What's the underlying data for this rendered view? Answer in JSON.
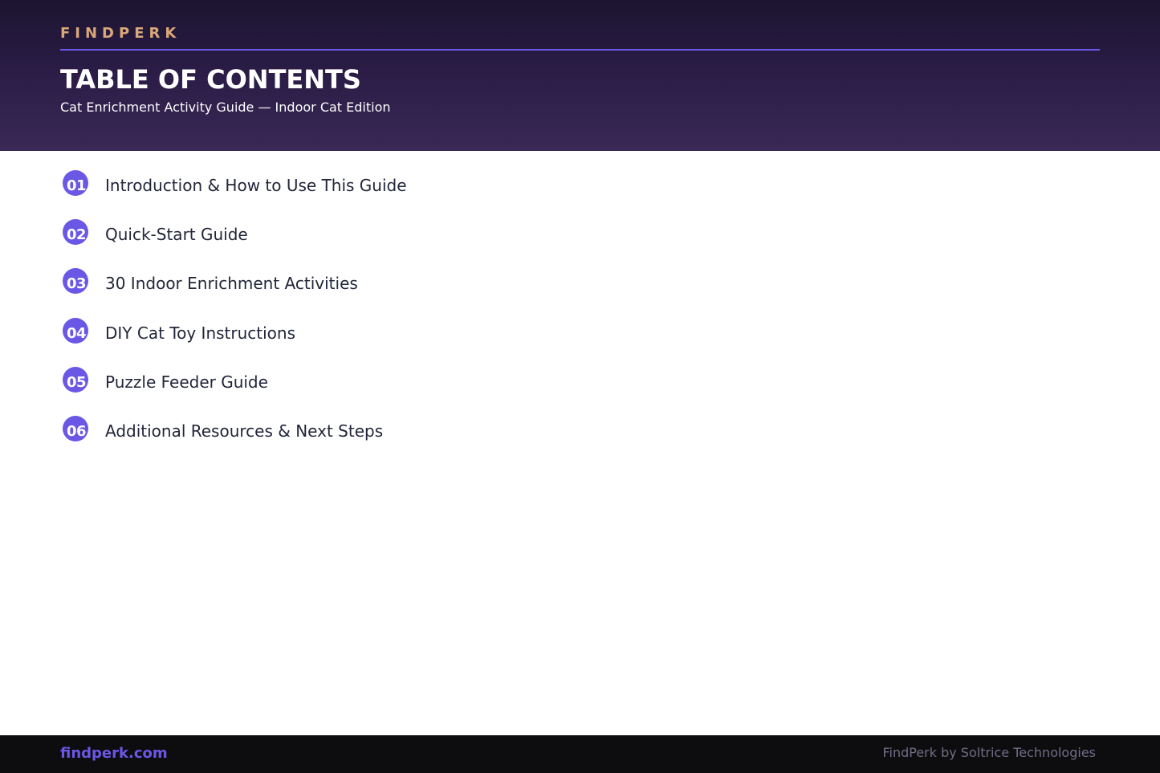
{
  "header": {
    "brand": "FINDPERK",
    "title": "TABLE OF CONTENTS",
    "subtitle": "Cat Enrichment Activity Guide — Indoor Cat Edition"
  },
  "toc": {
    "items": [
      {
        "number": "01",
        "label": "Introduction & How to Use This Guide"
      },
      {
        "number": "02",
        "label": "Quick-Start Guide"
      },
      {
        "number": "03",
        "label": "30 Indoor Enrichment Activities"
      },
      {
        "number": "04",
        "label": "DIY Cat Toy Instructions"
      },
      {
        "number": "05",
        "label": "Puzzle Feeder Guide"
      },
      {
        "number": "06",
        "label": "Additional Resources & Next Steps"
      }
    ]
  },
  "footer": {
    "site": "findperk.com",
    "credit": "FindPerk by Soltrice Technologies"
  },
  "colors": {
    "accent": "#6b57e6",
    "brand": "#d9a77a",
    "header_dark": "#1c1430",
    "header_light": "#3a2856",
    "footer_bg": "#0d0d0f"
  }
}
